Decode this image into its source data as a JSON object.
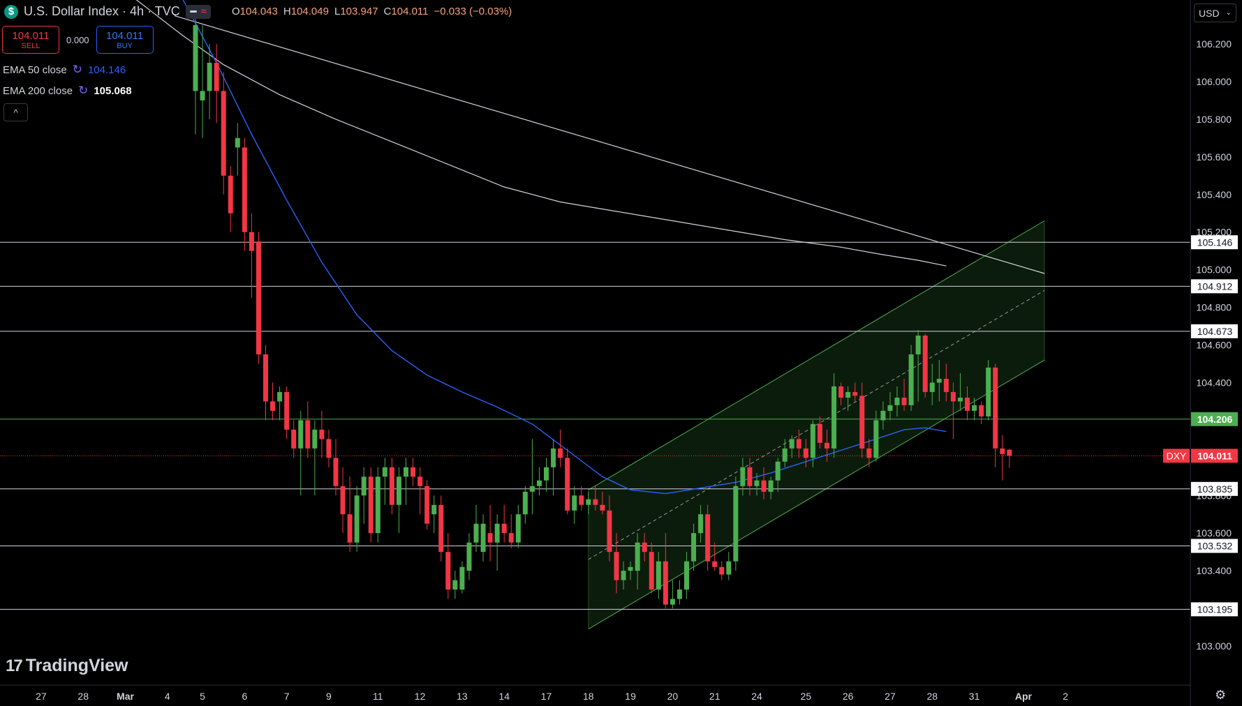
{
  "header": {
    "symbol_icon": "$",
    "title": "U.S. Dollar Index · 4h · TVC",
    "indicator_icon": "wave-icon",
    "ohlc": {
      "o_label": "O",
      "o": "104.043",
      "h_label": "H",
      "h": "104.049",
      "l_label": "L",
      "l": "103.947",
      "c_label": "C",
      "c": "104.011",
      "change": "−0.033 (−0.03%)"
    }
  },
  "trade": {
    "sell_price": "104.011",
    "sell_label": "SELL",
    "spread": "0.000",
    "buy_price": "104.011",
    "buy_label": "BUY"
  },
  "indicators": [
    {
      "label": "EMA 50 close",
      "value": "104.146"
    },
    {
      "label": "EMA 200 close",
      "value": "105.068"
    }
  ],
  "collapse_icon": "^",
  "logo": {
    "mark": "17",
    "text": "TradingView"
  },
  "currency": {
    "label": "USD",
    "chevron": "⌄"
  },
  "settings_icon": "⚙",
  "colors": {
    "bg": "#000000",
    "up": "#4caf50",
    "down": "#f23645",
    "ema50": "#2962ff",
    "ema200": "#d1d4dc",
    "channel": "#4caf50",
    "channel_fill": "#0d1f0d",
    "level": "#d1d4dc",
    "green_level": "#4caf50",
    "price_line": "#f23645"
  },
  "chart_data": {
    "type": "candlestick",
    "title": "U.S. Dollar Index · 4h · TVC",
    "ylim": [
      102.8,
      106.35
    ],
    "y_ticks": [
      "103.000",
      "103.200",
      "103.400",
      "103.600",
      "103.800",
      "104.000",
      "104.200",
      "104.400",
      "104.600",
      "104.800",
      "105.000",
      "105.200",
      "105.400",
      "105.600",
      "105.800",
      "106.000",
      "106.200"
    ],
    "x_labels": [
      {
        "label": "27",
        "i": -22
      },
      {
        "label": "28",
        "i": -16
      },
      {
        "label": "Mar",
        "i": -10
      },
      {
        "label": "4",
        "i": -4
      },
      {
        "label": "5",
        "i": 1
      },
      {
        "label": "6",
        "i": 7
      },
      {
        "label": "7",
        "i": 13
      },
      {
        "label": "9",
        "i": 19
      },
      {
        "label": "11",
        "i": 26
      },
      {
        "label": "12",
        "i": 32
      },
      {
        "label": "13",
        "i": 38
      },
      {
        "label": "14",
        "i": 44
      },
      {
        "label": "17",
        "i": 50
      },
      {
        "label": "18",
        "i": 56
      },
      {
        "label": "19",
        "i": 62
      },
      {
        "label": "20",
        "i": 68
      },
      {
        "label": "21",
        "i": 74
      },
      {
        "label": "24",
        "i": 80
      },
      {
        "label": "25",
        "i": 87
      },
      {
        "label": "26",
        "i": 93
      },
      {
        "label": "27",
        "i": 99
      },
      {
        "label": "28",
        "i": 105
      },
      {
        "label": "31",
        "i": 111
      },
      {
        "label": "Apr",
        "i": 118
      },
      {
        "label": "2",
        "i": 124
      }
    ],
    "levels": [
      {
        "value": 105.146,
        "label": "105.146"
      },
      {
        "value": 104.912,
        "label": "104.912"
      },
      {
        "value": 104.673,
        "label": "104.673"
      },
      {
        "value": 103.835,
        "label": "103.835"
      },
      {
        "value": 103.532,
        "label": "103.532"
      },
      {
        "value": 103.195,
        "label": "103.195"
      }
    ],
    "green_level": {
      "value": 104.206,
      "label": "104.206"
    },
    "current_price": {
      "value": 104.011,
      "label": "104.011",
      "symbol": "DXY"
    },
    "channel": {
      "i_start": 56,
      "i_end": 121,
      "lower_start": 103.09,
      "lower_end": 104.52,
      "upper_start": 103.83,
      "upper_end": 105.26
    },
    "ema200": [
      [
        -10,
        106.48
      ],
      [
        -2,
        106.25
      ],
      [
        4,
        106.09
      ],
      [
        12,
        105.93
      ],
      [
        20,
        105.8
      ],
      [
        28,
        105.68
      ],
      [
        36,
        105.56
      ],
      [
        44,
        105.44
      ],
      [
        52,
        105.36
      ],
      [
        60,
        105.31
      ],
      [
        68,
        105.26
      ],
      [
        76,
        105.21
      ],
      [
        84,
        105.16
      ],
      [
        92,
        105.12
      ],
      [
        98,
        105.08
      ],
      [
        103,
        105.05
      ],
      [
        107,
        105.02
      ]
    ],
    "trendline": [
      [
        -3,
        106.35
      ],
      [
        121,
        104.98
      ]
    ],
    "ema50": [
      [
        -2,
        106.45
      ],
      [
        3,
        106.1
      ],
      [
        8,
        105.72
      ],
      [
        13,
        105.37
      ],
      [
        18,
        105.04
      ],
      [
        23,
        104.76
      ],
      [
        28,
        104.57
      ],
      [
        33,
        104.44
      ],
      [
        38,
        104.35
      ],
      [
        43,
        104.27
      ],
      [
        48,
        104.18
      ],
      [
        53,
        104.04
      ],
      [
        58,
        103.9
      ],
      [
        62,
        103.83
      ],
      [
        67,
        103.81
      ],
      [
        72,
        103.84
      ],
      [
        77,
        103.87
      ],
      [
        82,
        103.92
      ],
      [
        87,
        103.98
      ],
      [
        92,
        104.04
      ],
      [
        97,
        104.1
      ],
      [
        101,
        104.15
      ],
      [
        104,
        104.16
      ],
      [
        107,
        104.14
      ]
    ],
    "candles": [
      {
        "o": 105.95,
        "h": 106.38,
        "l": 105.72,
        "c": 106.3
      },
      {
        "o": 105.9,
        "h": 106.3,
        "l": 105.7,
        "c": 105.95
      },
      {
        "o": 105.95,
        "h": 106.2,
        "l": 105.8,
        "c": 106.1
      },
      {
        "o": 106.1,
        "h": 106.2,
        "l": 105.78,
        "c": 105.95
      },
      {
        "o": 105.95,
        "h": 106.05,
        "l": 105.4,
        "c": 105.5
      },
      {
        "o": 105.5,
        "h": 105.55,
        "l": 105.2,
        "c": 105.3
      },
      {
        "o": 105.65,
        "h": 105.78,
        "l": 105.5,
        "c": 105.7
      },
      {
        "o": 105.65,
        "h": 105.7,
        "l": 105.1,
        "c": 105.2
      },
      {
        "o": 105.2,
        "h": 105.3,
        "l": 104.85,
        "c": 105.1
      },
      {
        "o": 105.15,
        "h": 105.2,
        "l": 104.5,
        "c": 104.55
      },
      {
        "o": 104.55,
        "h": 104.6,
        "l": 104.2,
        "c": 104.3
      },
      {
        "o": 104.3,
        "h": 104.4,
        "l": 104.2,
        "c": 104.25
      },
      {
        "o": 104.3,
        "h": 104.38,
        "l": 104.2,
        "c": 104.35
      },
      {
        "o": 104.35,
        "h": 104.38,
        "l": 104.1,
        "c": 104.15
      },
      {
        "o": 104.15,
        "h": 104.2,
        "l": 104.0,
        "c": 104.05
      },
      {
        "o": 104.05,
        "h": 104.25,
        "l": 103.8,
        "c": 104.2
      },
      {
        "o": 104.2,
        "h": 104.3,
        "l": 104.0,
        "c": 104.05
      },
      {
        "o": 104.05,
        "h": 104.2,
        "l": 103.8,
        "c": 104.15
      },
      {
        "o": 104.15,
        "h": 104.25,
        "l": 104.0,
        "c": 104.1
      },
      {
        "o": 104.1,
        "h": 104.15,
        "l": 103.95,
        "c": 104.0
      },
      {
        "o": 104.0,
        "h": 104.1,
        "l": 103.8,
        "c": 103.85
      },
      {
        "o": 103.85,
        "h": 103.95,
        "l": 103.6,
        "c": 103.7
      },
      {
        "o": 103.7,
        "h": 103.9,
        "l": 103.5,
        "c": 103.55
      },
      {
        "o": 103.55,
        "h": 103.85,
        "l": 103.5,
        "c": 103.8
      },
      {
        "o": 103.8,
        "h": 103.95,
        "l": 103.65,
        "c": 103.9
      },
      {
        "o": 103.9,
        "h": 103.95,
        "l": 103.55,
        "c": 103.6
      },
      {
        "o": 103.6,
        "h": 103.95,
        "l": 103.55,
        "c": 103.9
      },
      {
        "o": 103.9,
        "h": 104.0,
        "l": 103.75,
        "c": 103.95
      },
      {
        "o": 103.95,
        "h": 104.0,
        "l": 103.7,
        "c": 103.75
      },
      {
        "o": 103.75,
        "h": 103.95,
        "l": 103.6,
        "c": 103.9
      },
      {
        "o": 103.9,
        "h": 104.0,
        "l": 103.75,
        "c": 103.95
      },
      {
        "o": 103.95,
        "h": 104.0,
        "l": 103.85,
        "c": 103.9
      },
      {
        "o": 103.9,
        "h": 103.95,
        "l": 103.7,
        "c": 103.85
      },
      {
        "o": 103.85,
        "h": 103.88,
        "l": 103.62,
        "c": 103.65
      },
      {
        "o": 103.7,
        "h": 103.8,
        "l": 103.6,
        "c": 103.75
      },
      {
        "o": 103.75,
        "h": 103.8,
        "l": 103.45,
        "c": 103.5
      },
      {
        "o": 103.5,
        "h": 103.6,
        "l": 103.25,
        "c": 103.3
      },
      {
        "o": 103.3,
        "h": 103.4,
        "l": 103.25,
        "c": 103.35
      },
      {
        "o": 103.3,
        "h": 103.45,
        "l": 103.28,
        "c": 103.42
      },
      {
        "o": 103.4,
        "h": 103.6,
        "l": 103.35,
        "c": 103.55
      },
      {
        "o": 103.55,
        "h": 103.75,
        "l": 103.5,
        "c": 103.65
      },
      {
        "o": 103.5,
        "h": 103.7,
        "l": 103.45,
        "c": 103.65
      },
      {
        "o": 103.6,
        "h": 103.75,
        "l": 103.45,
        "c": 103.55
      },
      {
        "o": 103.55,
        "h": 103.7,
        "l": 103.4,
        "c": 103.65
      },
      {
        "o": 103.65,
        "h": 103.75,
        "l": 103.55,
        "c": 103.6
      },
      {
        "o": 103.6,
        "h": 103.7,
        "l": 103.52,
        "c": 103.55
      },
      {
        "o": 103.55,
        "h": 103.75,
        "l": 103.52,
        "c": 103.7
      },
      {
        "o": 103.7,
        "h": 103.85,
        "l": 103.65,
        "c": 103.82
      },
      {
        "o": 103.82,
        "h": 104.1,
        "l": 103.7,
        "c": 103.85
      },
      {
        "o": 103.85,
        "h": 103.95,
        "l": 103.8,
        "c": 103.88
      },
      {
        "o": 103.88,
        "h": 104.0,
        "l": 103.82,
        "c": 103.95
      },
      {
        "o": 103.95,
        "h": 104.1,
        "l": 103.8,
        "c": 104.05
      },
      {
        "o": 104.05,
        "h": 104.15,
        "l": 103.95,
        "c": 104.0
      },
      {
        "o": 104.0,
        "h": 104.05,
        "l": 103.7,
        "c": 103.72
      },
      {
        "o": 103.72,
        "h": 103.85,
        "l": 103.65,
        "c": 103.8
      },
      {
        "o": 103.8,
        "h": 103.85,
        "l": 103.72,
        "c": 103.75
      },
      {
        "o": 103.75,
        "h": 103.82,
        "l": 103.7,
        "c": 103.78
      },
      {
        "o": 103.78,
        "h": 103.85,
        "l": 103.72,
        "c": 103.75
      },
      {
        "o": 103.75,
        "h": 103.82,
        "l": 103.7,
        "c": 103.72
      },
      {
        "o": 103.72,
        "h": 103.8,
        "l": 103.45,
        "c": 103.5
      },
      {
        "o": 103.5,
        "h": 103.6,
        "l": 103.28,
        "c": 103.35
      },
      {
        "o": 103.35,
        "h": 103.45,
        "l": 103.3,
        "c": 103.4
      },
      {
        "o": 103.4,
        "h": 103.45,
        "l": 103.35,
        "c": 103.42
      },
      {
        "o": 103.4,
        "h": 103.6,
        "l": 103.3,
        "c": 103.55
      },
      {
        "o": 103.55,
        "h": 103.6,
        "l": 103.45,
        "c": 103.5
      },
      {
        "o": 103.5,
        "h": 103.55,
        "l": 103.28,
        "c": 103.3
      },
      {
        "o": 103.3,
        "h": 103.5,
        "l": 103.25,
        "c": 103.45
      },
      {
        "o": 103.45,
        "h": 103.6,
        "l": 103.2,
        "c": 103.22
      },
      {
        "o": 103.22,
        "h": 103.35,
        "l": 103.2,
        "c": 103.25
      },
      {
        "o": 103.25,
        "h": 103.35,
        "l": 103.22,
        "c": 103.3
      },
      {
        "o": 103.3,
        "h": 103.5,
        "l": 103.25,
        "c": 103.45
      },
      {
        "o": 103.45,
        "h": 103.65,
        "l": 103.4,
        "c": 103.6
      },
      {
        "o": 103.6,
        "h": 103.75,
        "l": 103.55,
        "c": 103.7
      },
      {
        "o": 103.7,
        "h": 103.75,
        "l": 103.4,
        "c": 103.45
      },
      {
        "o": 103.45,
        "h": 103.55,
        "l": 103.4,
        "c": 103.42
      },
      {
        "o": 103.42,
        "h": 103.45,
        "l": 103.35,
        "c": 103.38
      },
      {
        "o": 103.38,
        "h": 103.5,
        "l": 103.35,
        "c": 103.45
      },
      {
        "o": 103.45,
        "h": 103.9,
        "l": 103.4,
        "c": 103.85
      },
      {
        "o": 103.85,
        "h": 104.0,
        "l": 103.8,
        "c": 103.95
      },
      {
        "o": 103.95,
        "h": 104.0,
        "l": 103.8,
        "c": 103.85
      },
      {
        "o": 103.85,
        "h": 103.92,
        "l": 103.8,
        "c": 103.88
      },
      {
        "o": 103.88,
        "h": 103.95,
        "l": 103.78,
        "c": 103.82
      },
      {
        "o": 103.82,
        "h": 103.9,
        "l": 103.78,
        "c": 103.88
      },
      {
        "o": 103.88,
        "h": 104.0,
        "l": 103.82,
        "c": 103.98
      },
      {
        "o": 103.98,
        "h": 104.1,
        "l": 103.95,
        "c": 104.05
      },
      {
        "o": 104.05,
        "h": 104.12,
        "l": 104.0,
        "c": 104.1
      },
      {
        "o": 104.1,
        "h": 104.15,
        "l": 104.0,
        "c": 104.05
      },
      {
        "o": 104.05,
        "h": 104.1,
        "l": 103.95,
        "c": 104.0
      },
      {
        "o": 104.0,
        "h": 104.2,
        "l": 103.95,
        "c": 104.18
      },
      {
        "o": 104.18,
        "h": 104.22,
        "l": 104.05,
        "c": 104.08
      },
      {
        "o": 104.08,
        "h": 104.15,
        "l": 103.98,
        "c": 104.05
      },
      {
        "o": 104.05,
        "h": 104.45,
        "l": 104.0,
        "c": 104.38
      },
      {
        "o": 104.38,
        "h": 104.4,
        "l": 104.28,
        "c": 104.32
      },
      {
        "o": 104.32,
        "h": 104.38,
        "l": 104.25,
        "c": 104.35
      },
      {
        "o": 104.35,
        "h": 104.4,
        "l": 104.3,
        "c": 104.33
      },
      {
        "o": 104.33,
        "h": 104.4,
        "l": 104.0,
        "c": 104.05
      },
      {
        "o": 104.05,
        "h": 104.1,
        "l": 103.95,
        "c": 104.0
      },
      {
        "o": 104.0,
        "h": 104.25,
        "l": 103.98,
        "c": 104.2
      },
      {
        "o": 104.2,
        "h": 104.3,
        "l": 104.15,
        "c": 104.25
      },
      {
        "o": 104.25,
        "h": 104.35,
        "l": 104.2,
        "c": 104.28
      },
      {
        "o": 104.28,
        "h": 104.38,
        "l": 104.22,
        "c": 104.32
      },
      {
        "o": 104.32,
        "h": 104.42,
        "l": 104.25,
        "c": 104.28
      },
      {
        "o": 104.28,
        "h": 104.6,
        "l": 104.25,
        "c": 104.55
      },
      {
        "o": 104.55,
        "h": 104.68,
        "l": 104.3,
        "c": 104.65
      },
      {
        "o": 104.65,
        "h": 104.66,
        "l": 104.32,
        "c": 104.35
      },
      {
        "o": 104.35,
        "h": 104.5,
        "l": 104.28,
        "c": 104.4
      },
      {
        "o": 104.4,
        "h": 104.52,
        "l": 104.3,
        "c": 104.42
      },
      {
        "o": 104.42,
        "h": 104.5,
        "l": 104.3,
        "c": 104.35
      },
      {
        "o": 104.35,
        "h": 104.4,
        "l": 104.1,
        "c": 104.3
      },
      {
        "o": 104.3,
        "h": 104.45,
        "l": 104.25,
        "c": 104.32
      },
      {
        "o": 104.32,
        "h": 104.38,
        "l": 104.2,
        "c": 104.25
      },
      {
        "o": 104.25,
        "h": 104.32,
        "l": 104.2,
        "c": 104.28
      },
      {
        "o": 104.28,
        "h": 104.3,
        "l": 104.18,
        "c": 104.22
      },
      {
        "o": 104.22,
        "h": 104.52,
        "l": 104.2,
        "c": 104.48
      },
      {
        "o": 104.48,
        "h": 104.5,
        "l": 103.95,
        "c": 104.05
      },
      {
        "o": 104.05,
        "h": 104.12,
        "l": 103.88,
        "c": 104.02
      },
      {
        "o": 104.043,
        "h": 104.049,
        "l": 103.947,
        "c": 104.011
      }
    ]
  }
}
